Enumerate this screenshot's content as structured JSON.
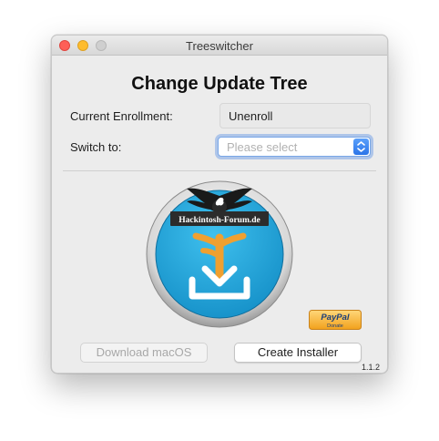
{
  "window": {
    "title": "Treeswitcher"
  },
  "heading": "Change Update Tree",
  "current_enrollment": {
    "label": "Current Enrollment:",
    "value": "Unenroll"
  },
  "switch_to": {
    "label": "Switch to:",
    "placeholder": "Please select"
  },
  "app_icon": {
    "banner_text": "Hackintosh-Forum.de",
    "icon_name": "download-icon"
  },
  "paypal": {
    "brand_text": "PayPal",
    "sub_text": "Donate"
  },
  "buttons": {
    "download_label": "Download macOS",
    "create_label": "Create Installer"
  },
  "version": "1.1.2",
  "colors": {
    "accent": "#2b74e8",
    "icon_blue": "#1ea3dc",
    "icon_orange": "#f0a030"
  }
}
